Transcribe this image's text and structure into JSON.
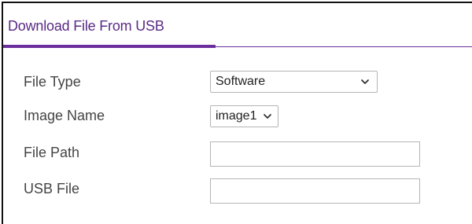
{
  "panel": {
    "title": "Download File From USB"
  },
  "form": {
    "file_type": {
      "label": "File Type",
      "value": "Software",
      "icon": "chevron-down-icon"
    },
    "image_name": {
      "label": "Image Name",
      "value": "image1",
      "icon": "chevron-down-icon"
    },
    "file_path": {
      "label": "File Path",
      "value": "",
      "placeholder": ""
    },
    "usb_file": {
      "label": "USB File",
      "value": "",
      "placeholder": ""
    }
  },
  "colors": {
    "accent": "#6b2f9c",
    "title": "#5a2a86",
    "label": "#444444",
    "input_border": "#b5b5b5"
  }
}
